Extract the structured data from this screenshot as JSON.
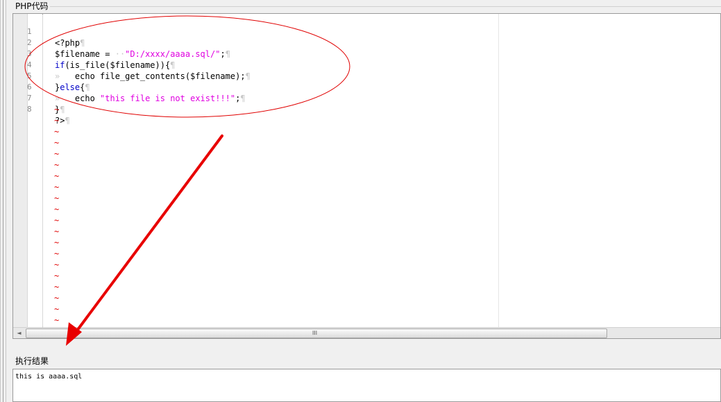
{
  "php_section": {
    "label": "PHP代码"
  },
  "editor": {
    "lines": [
      {
        "num": "1"
      },
      {
        "num": "2"
      },
      {
        "num": "3"
      },
      {
        "num": "4"
      },
      {
        "num": "5"
      },
      {
        "num": "6"
      },
      {
        "num": "7"
      },
      {
        "num": "8"
      }
    ],
    "code": {
      "l1": "<?php",
      "l2_var": "$filename = ",
      "l2_str": "\"D:/xxxx/aaaa.sql/\"",
      "l2_end": ";",
      "l3_kw": "if",
      "l3_rest": "(is_file($filename)){",
      "l4": "echo file_get_contents($filename);",
      "l5_brace": "}",
      "l5_kw": "else",
      "l5_end": "{",
      "l6_echo": "echo ",
      "l6_str": "\"this file is not exist!!!\"",
      "l6_end": ";",
      "l7": "}",
      "l8": "?>",
      "pilcrow": "¶",
      "tab_mark": "»",
      "space_mark": "·",
      "empty_line_marker": "~"
    },
    "scroll_grip": "III",
    "scroll_left_arrow": "◄"
  },
  "result_section": {
    "label": "执行结果",
    "output": "this is aaaa.sql"
  },
  "colors": {
    "keyword": "#0000c8",
    "string": "#e000e0",
    "tilde": "#e00000",
    "annotation": "#e00000"
  }
}
